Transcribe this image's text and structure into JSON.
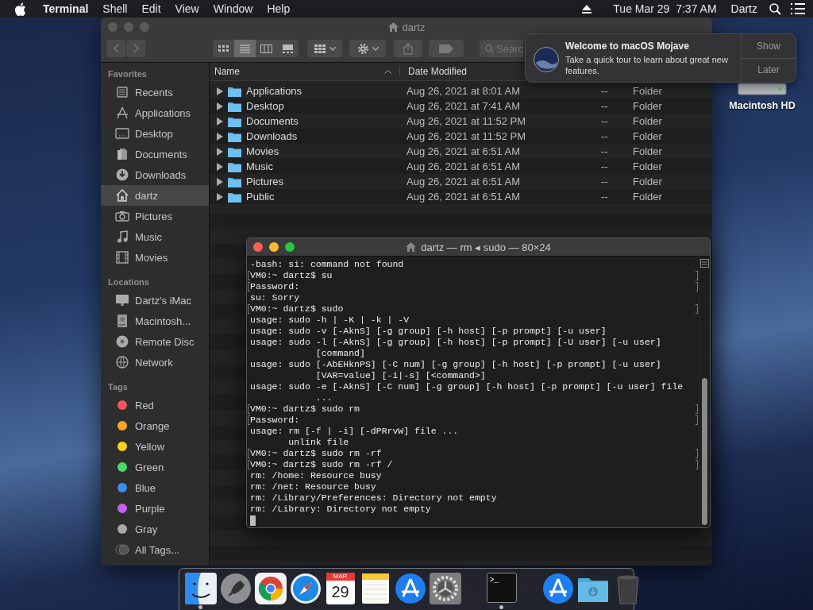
{
  "menubar": {
    "app_name": "Terminal",
    "menus": [
      "Shell",
      "Edit",
      "View",
      "Window",
      "Help"
    ],
    "clock": "Tue Mar 29  7:37 AM",
    "user": "Dartz"
  },
  "desktop_icons": [
    {
      "label": "Macintosh HD"
    }
  ],
  "finder": {
    "title": "dartz",
    "search": {
      "placeholder": "Searc"
    },
    "views": [
      {
        "kind": "icons",
        "selected": false
      },
      {
        "kind": "list",
        "selected": true
      },
      {
        "kind": "columns",
        "selected": false
      },
      {
        "kind": "gallery",
        "selected": false
      }
    ],
    "sidebar": [
      {
        "heading": "Favorites",
        "items": [
          {
            "label": "Recents",
            "kind": "recents",
            "selected": false
          },
          {
            "label": "Applications",
            "kind": "applications",
            "selected": false
          },
          {
            "label": "Desktop",
            "kind": "desktop",
            "selected": false
          },
          {
            "label": "Documents",
            "kind": "documents",
            "selected": false
          },
          {
            "label": "Downloads",
            "kind": "downloads",
            "selected": false
          },
          {
            "label": "dartz",
            "kind": "home",
            "selected": true
          },
          {
            "label": "Pictures",
            "kind": "pictures",
            "selected": false
          },
          {
            "label": "Music",
            "kind": "music",
            "selected": false
          },
          {
            "label": "Movies",
            "kind": "movies",
            "selected": false
          }
        ]
      },
      {
        "heading": "Locations",
        "items": [
          {
            "label": "Dartz's iMac",
            "kind": "computer",
            "selected": false
          },
          {
            "label": "Macintosh...",
            "kind": "disk",
            "selected": false
          },
          {
            "label": "Remote Disc",
            "kind": "disc",
            "selected": false
          },
          {
            "label": "Network",
            "kind": "network",
            "selected": false
          }
        ]
      },
      {
        "heading": "Tags",
        "items": [
          {
            "label": "Red",
            "kind": "tag",
            "color": "#f2545b",
            "selected": false
          },
          {
            "label": "Orange",
            "kind": "tag",
            "color": "#f5a623",
            "selected": false
          },
          {
            "label": "Yellow",
            "kind": "tag",
            "color": "#f7d51d",
            "selected": false
          },
          {
            "label": "Green",
            "kind": "tag",
            "color": "#4cd964",
            "selected": false
          },
          {
            "label": "Blue",
            "kind": "tag",
            "color": "#3b8ef3",
            "selected": false
          },
          {
            "label": "Purple",
            "kind": "tag",
            "color": "#c063ee",
            "selected": false
          },
          {
            "label": "Gray",
            "kind": "tag",
            "color": "#a9a9a9",
            "selected": false
          },
          {
            "label": "All Tags...",
            "kind": "alltags",
            "selected": false
          }
        ]
      }
    ],
    "columns": [
      "Name",
      "Date Modified"
    ],
    "rows": [
      {
        "name": "Applications",
        "date_modified": "Aug 26, 2021 at 8:01 AM",
        "column_3": "--",
        "column_4": "Folder"
      },
      {
        "name": "Desktop",
        "date_modified": "Aug 26, 2021 at 7:41 AM",
        "column_3": "--",
        "column_4": "Folder"
      },
      {
        "name": "Documents",
        "date_modified": "Aug 26, 2021 at 11:52 PM",
        "column_3": "--",
        "column_4": "Folder"
      },
      {
        "name": "Downloads",
        "date_modified": "Aug 26, 2021 at 11:52 PM",
        "column_3": "--",
        "column_4": "Folder"
      },
      {
        "name": "Movies",
        "date_modified": "Aug 26, 2021 at 6:51 AM",
        "column_3": "--",
        "column_4": "Folder"
      },
      {
        "name": "Music",
        "date_modified": "Aug 26, 2021 at 6:51 AM",
        "column_3": "--",
        "column_4": "Folder"
      },
      {
        "name": "Pictures",
        "date_modified": "Aug 26, 2021 at 6:51 AM",
        "column_3": "--",
        "column_4": "Folder"
      },
      {
        "name": "Public",
        "date_modified": "Aug 26, 2021 at 6:51 AM",
        "column_3": "--",
        "column_4": "Folder"
      }
    ]
  },
  "notification": {
    "title": "Welcome to macOS Mojave",
    "body": "Take a quick tour to learn about great new features.",
    "buttons": [
      "Show",
      "Later"
    ]
  },
  "terminal": {
    "title": "dartz — rm ◂ sudo — 80×24",
    "cursor": true,
    "lines": [
      {
        "text": "-bash: si: command not found",
        "marked": false
      },
      {
        "text": "VM0:~ dartz$ su",
        "marked": true
      },
      {
        "text": "Password:",
        "marked": true
      },
      {
        "text": "su: Sorry",
        "marked": false
      },
      {
        "text": "VM0:~ dartz$ sudo",
        "marked": true
      },
      {
        "text": "usage: sudo -h | -K | -k | -V",
        "marked": false
      },
      {
        "text": "usage: sudo -v [-AknS] [-g group] [-h host] [-p prompt] [-u user]",
        "marked": false
      },
      {
        "text": "usage: sudo -l [-AknS] [-g group] [-h host] [-p prompt] [-U user] [-u user]",
        "marked": false
      },
      {
        "text": "            [command]",
        "marked": false
      },
      {
        "text": "usage: sudo [-AbEHknPS] [-C num] [-g group] [-h host] [-p prompt] [-u user]",
        "marked": false
      },
      {
        "text": "            [VAR=value] [-i|-s] [<command>]",
        "marked": false
      },
      {
        "text": "usage: sudo -e [-AknS] [-C num] [-g group] [-h host] [-p prompt] [-u user] file",
        "marked": false
      },
      {
        "text": "            ...",
        "marked": false
      },
      {
        "text": "VM0:~ dartz$ sudo rm",
        "marked": true
      },
      {
        "text": "Password:",
        "marked": true
      },
      {
        "text": "usage: rm [-f | -i] [-dPRrvW] file ...",
        "marked": false
      },
      {
        "text": "       unlink file",
        "marked": false
      },
      {
        "text": "VM0:~ dartz$ sudo rm -rf",
        "marked": true
      },
      {
        "text": "VM0:~ dartz$ sudo rm -rf /",
        "marked": true
      },
      {
        "text": "rm: /home: Resource busy",
        "marked": false
      },
      {
        "text": "rm: /net: Resource busy",
        "marked": false
      },
      {
        "text": "rm: /Library/Preferences: Directory not empty",
        "marked": false
      },
      {
        "text": "rm: /Library: Directory not empty",
        "marked": false
      }
    ]
  },
  "dock": {
    "sections": [
      {
        "items": [
          {
            "kind": "finder",
            "running": true
          },
          {
            "kind": "launchpad"
          },
          {
            "kind": "chrome"
          },
          {
            "kind": "safari"
          },
          {
            "kind": "calendar",
            "month": "MAR",
            "day": "29"
          },
          {
            "kind": "notes"
          },
          {
            "kind": "appstore"
          },
          {
            "kind": "preferences"
          }
        ]
      },
      {
        "items": [
          {
            "kind": "terminal",
            "glyph": ">_",
            "running": true
          }
        ]
      },
      {
        "items": [
          {
            "kind": "appstore"
          },
          {
            "kind": "downloads"
          },
          {
            "kind": "trash"
          }
        ]
      }
    ]
  }
}
